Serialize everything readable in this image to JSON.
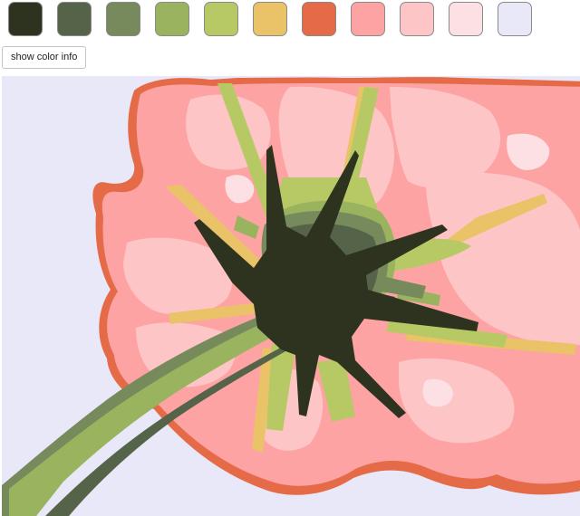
{
  "palette": {
    "swatches": [
      {
        "name": "swatch-1",
        "color": "#2d331f"
      },
      {
        "name": "swatch-2",
        "color": "#556348"
      },
      {
        "name": "swatch-3",
        "color": "#778a5c"
      },
      {
        "name": "swatch-4",
        "color": "#99b35f"
      },
      {
        "name": "swatch-5",
        "color": "#b7c964"
      },
      {
        "name": "swatch-6",
        "color": "#eac268"
      },
      {
        "name": "swatch-7",
        "color": "#e56a48"
      },
      {
        "name": "swatch-8",
        "color": "#fda3a4"
      },
      {
        "name": "swatch-9",
        "color": "#fec5c7"
      },
      {
        "name": "swatch-10",
        "color": "#fde0e3"
      },
      {
        "name": "swatch-11",
        "color": "#e9e8f8"
      }
    ]
  },
  "controls": {
    "info_button_label": "show color info"
  },
  "artwork": {
    "background": "#e9e8f8",
    "subject": "flower-from-below"
  }
}
